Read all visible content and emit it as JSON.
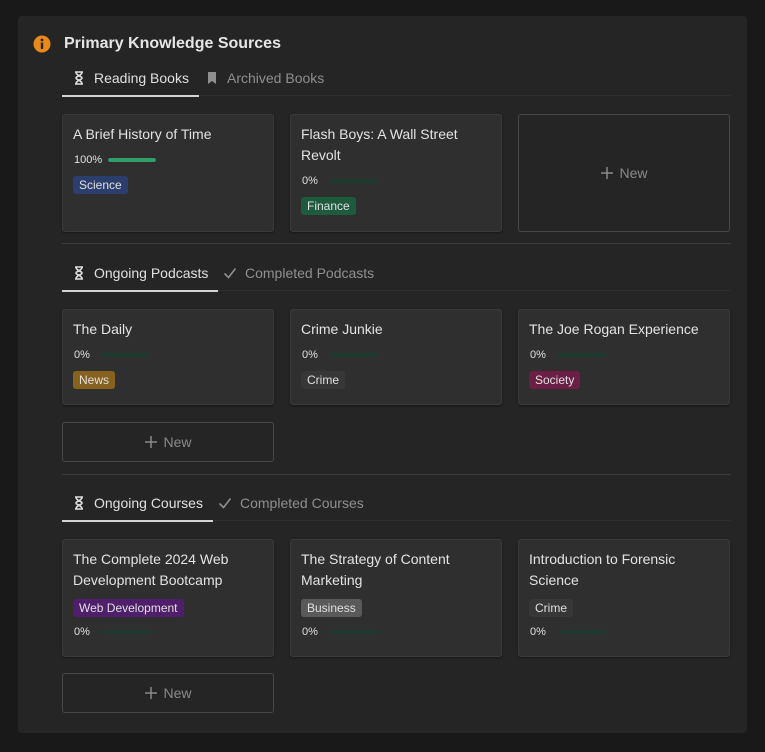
{
  "title": "Primary Knowledge Sources",
  "icons": {
    "info": "info-icon",
    "hourglass": "hourglass-icon",
    "bookmark": "bookmark-icon",
    "check": "checkmark-icon",
    "plus": "plus-icon"
  },
  "colors": {
    "accent_info": "#e8891a",
    "progress": "#2f9e6a"
  },
  "new_label": "New",
  "books": {
    "tab_active": "Reading Books",
    "tab_inactive": "Archived Books",
    "cards": [
      {
        "title": "A Brief History of Time",
        "progress": "100%",
        "progress_value": 1.0,
        "tag": "Science",
        "tag_color": "#2c3e6e"
      },
      {
        "title": "Flash Boys: A Wall Street Revolt",
        "progress": "0%",
        "progress_value": 0.0,
        "tag": "Finance",
        "tag_color": "#1e5a3e"
      }
    ]
  },
  "podcasts": {
    "tab_active": "Ongoing Podcasts",
    "tab_inactive": "Completed Podcasts",
    "cards": [
      {
        "title": "The Daily",
        "progress": "0%",
        "progress_value": 0.0,
        "tag": "News",
        "tag_color": "#86621e"
      },
      {
        "title": "Crime Junkie",
        "progress": "0%",
        "progress_value": 0.0,
        "tag": "Crime",
        "tag_color": "#373737"
      },
      {
        "title": "The Joe Rogan Experience",
        "progress": "0%",
        "progress_value": 0.0,
        "tag": "Society",
        "tag_color": "#6b1f45"
      }
    ]
  },
  "courses": {
    "tab_active": "Ongoing Courses",
    "tab_inactive": "Completed Courses",
    "cards": [
      {
        "title": "The Complete 2024 Web Development Bootcamp",
        "progress": "0%",
        "progress_value": 0.0,
        "tag": "Web Development",
        "tag_color": "#4f1f6b"
      },
      {
        "title": "The Strategy of Content Marketing",
        "progress": "0%",
        "progress_value": 0.0,
        "tag": "Business",
        "tag_color": "#5a5a5a"
      },
      {
        "title": "Introduction to Forensic Science",
        "progress": "0%",
        "progress_value": 0.0,
        "tag": "Crime",
        "tag_color": "#373737"
      }
    ]
  }
}
